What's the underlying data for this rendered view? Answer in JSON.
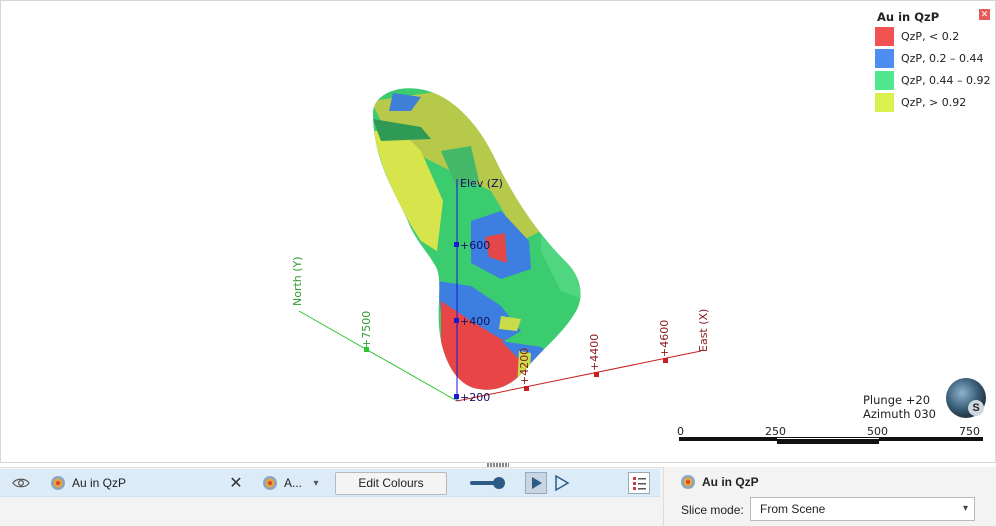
{
  "legend": {
    "title": "Au in QzP",
    "close_icon": "close-icon",
    "items": [
      {
        "label": "QzP, < 0.2",
        "color": "#f25252"
      },
      {
        "label": "QzP, 0.2 – 0.44",
        "color": "#4d8ef0"
      },
      {
        "label": "QzP, 0.44 – 0.92",
        "color": "#4fe88f"
      },
      {
        "label": "QzP, > 0.92",
        "color": "#d9f04d"
      }
    ]
  },
  "axes": {
    "elev_label": "Elev (Z)",
    "north_label": "North (Y)",
    "east_label": "East (X)",
    "z_ticks": [
      "+600",
      "+400",
      "+200"
    ],
    "y_ticks": [
      "+7500"
    ],
    "x_ticks": [
      "+4200",
      "+4400",
      "+4600"
    ]
  },
  "orientation": {
    "plunge": "Plunge +20",
    "azimuth": "Azimuth 030",
    "globe_letter": "S"
  },
  "scale_bar": {
    "labels": [
      "0",
      "250",
      "500",
      "750"
    ]
  },
  "toolbar": {
    "layer1_name": "Au in QzP",
    "layer2_name": "A...",
    "edit_colours": "Edit Colours"
  },
  "panel": {
    "title": "Au in QzP",
    "slice_mode_label": "Slice mode:",
    "slice_mode_value": "From Scene"
  },
  "colors": {
    "z_axis": "#1a1ad0",
    "y_axis": "#2ec42e",
    "x_axis": "#c81e1e",
    "selected_row": "#dcebf8"
  }
}
